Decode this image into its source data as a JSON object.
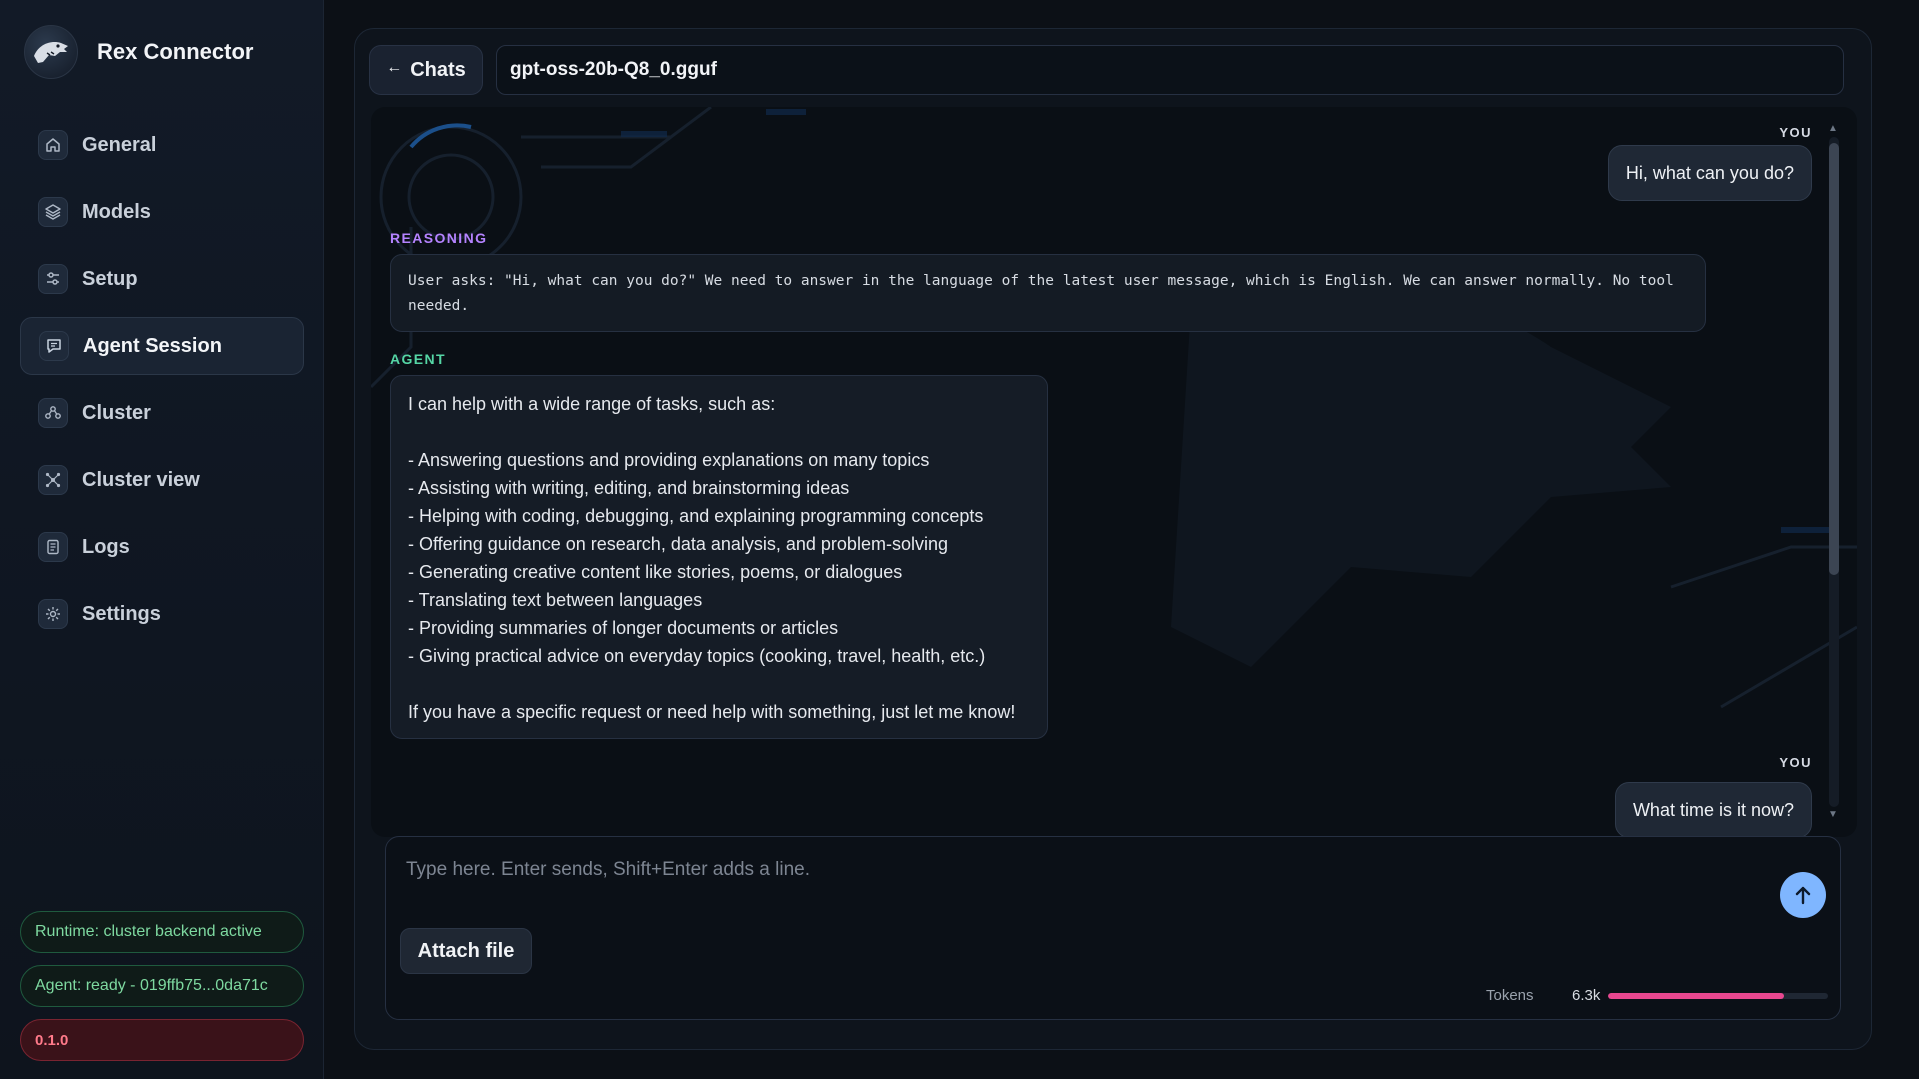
{
  "brand": {
    "title": "Rex Connector"
  },
  "sidebar": {
    "items": [
      {
        "label": "General",
        "icon": "home-icon"
      },
      {
        "label": "Models",
        "icon": "layers-icon"
      },
      {
        "label": "Setup",
        "icon": "sliders-icon"
      },
      {
        "label": "Agent Session",
        "icon": "chat-icon",
        "active": true
      },
      {
        "label": "Cluster",
        "icon": "cluster-icon"
      },
      {
        "label": "Cluster view",
        "icon": "network-icon"
      },
      {
        "label": "Logs",
        "icon": "logs-icon"
      },
      {
        "label": "Settings",
        "icon": "gear-icon"
      }
    ],
    "runtime_status": "Runtime: cluster backend active",
    "agent_status": "Agent: ready - 019ffb75...0da71c",
    "version": "0.1.0"
  },
  "header": {
    "back_label": "Chats",
    "model_name": "gpt-oss-20b-Q8_0.gguf"
  },
  "chat": {
    "messages": [
      {
        "role": "YOU",
        "text": "Hi, what can you do?"
      },
      {
        "role": "REASONING",
        "text": "User asks: \"Hi, what can you do?\" We need to answer in the language of the latest user message, which is English. We can answer normally. No tool needed."
      },
      {
        "role": "AGENT",
        "text": "I can help with a wide range of tasks, such as:\n\n- Answering questions and providing explanations on many topics\n- Assisting with writing, editing, and brainstorming ideas\n- Helping with coding, debugging, and explaining programming concepts\n- Offering guidance on research, data analysis, and problem-solving\n- Generating creative content like stories, poems, or dialogues\n- Translating text between languages\n- Providing summaries of longer documents or articles\n- Giving practical advice on everyday topics (cooking, travel, health, etc.)\n\nIf you have a specific request or need help with something, just let me know!"
      },
      {
        "role": "YOU",
        "text": "What time is it now?"
      }
    ]
  },
  "composer": {
    "placeholder": "Type here. Enter sends, Shift+Enter adds a line.",
    "attach_label": "Attach file",
    "tokens_label": "Tokens",
    "tokens_value": "6.3k",
    "tokens_fraction": 0.8
  },
  "colors": {
    "accent_send": "#7fb6ff",
    "reasoning": "#b583ff",
    "agent": "#55d6a5",
    "tokens_bar": "#e8478f",
    "status_ok": "#7ed9a0",
    "version": "#ff7a8a"
  }
}
